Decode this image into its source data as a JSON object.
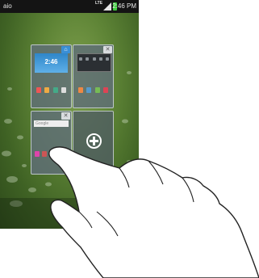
{
  "statusbar": {
    "carrier": "aio",
    "network": "LTE",
    "time": "2:46 PM"
  },
  "panels": {
    "home1": {
      "clock": "2:46"
    },
    "home3": {
      "search_label": "Google"
    }
  },
  "colors": {
    "wallpaper": "#5e8436",
    "statusbar": "#141414",
    "battery": "#3fcf3f",
    "panel": "#5f6e78"
  },
  "icons": [
    "signal-icon",
    "battery-icon",
    "remove-panel-icon",
    "add-panel-icon",
    "hand-gesture"
  ]
}
